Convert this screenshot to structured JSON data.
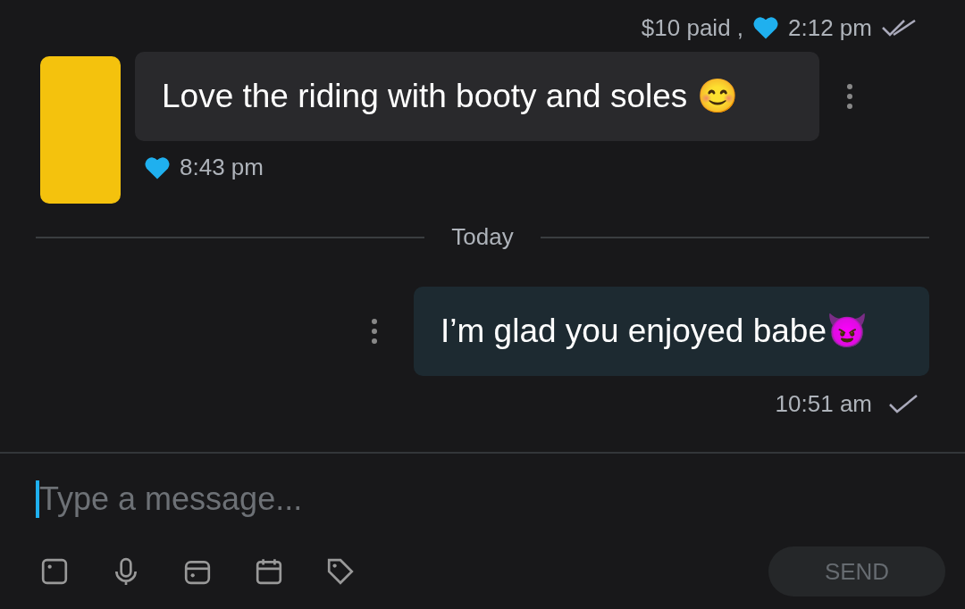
{
  "top_meta": {
    "paid": "$10 paid ,",
    "liked": true,
    "time": "2:12 pm",
    "read": true
  },
  "messages": [
    {
      "kind": "incoming",
      "text": "Love the riding with booty and soles 😊",
      "liked": true,
      "time": "8:43 pm"
    },
    {
      "kind": "divider",
      "text": "Today"
    },
    {
      "kind": "outgoing",
      "text": "I’m glad you enjoyed babe😈",
      "time": "10:51 am",
      "read": false
    }
  ],
  "composer": {
    "placeholder": "Type a message...",
    "send": "SEND"
  }
}
